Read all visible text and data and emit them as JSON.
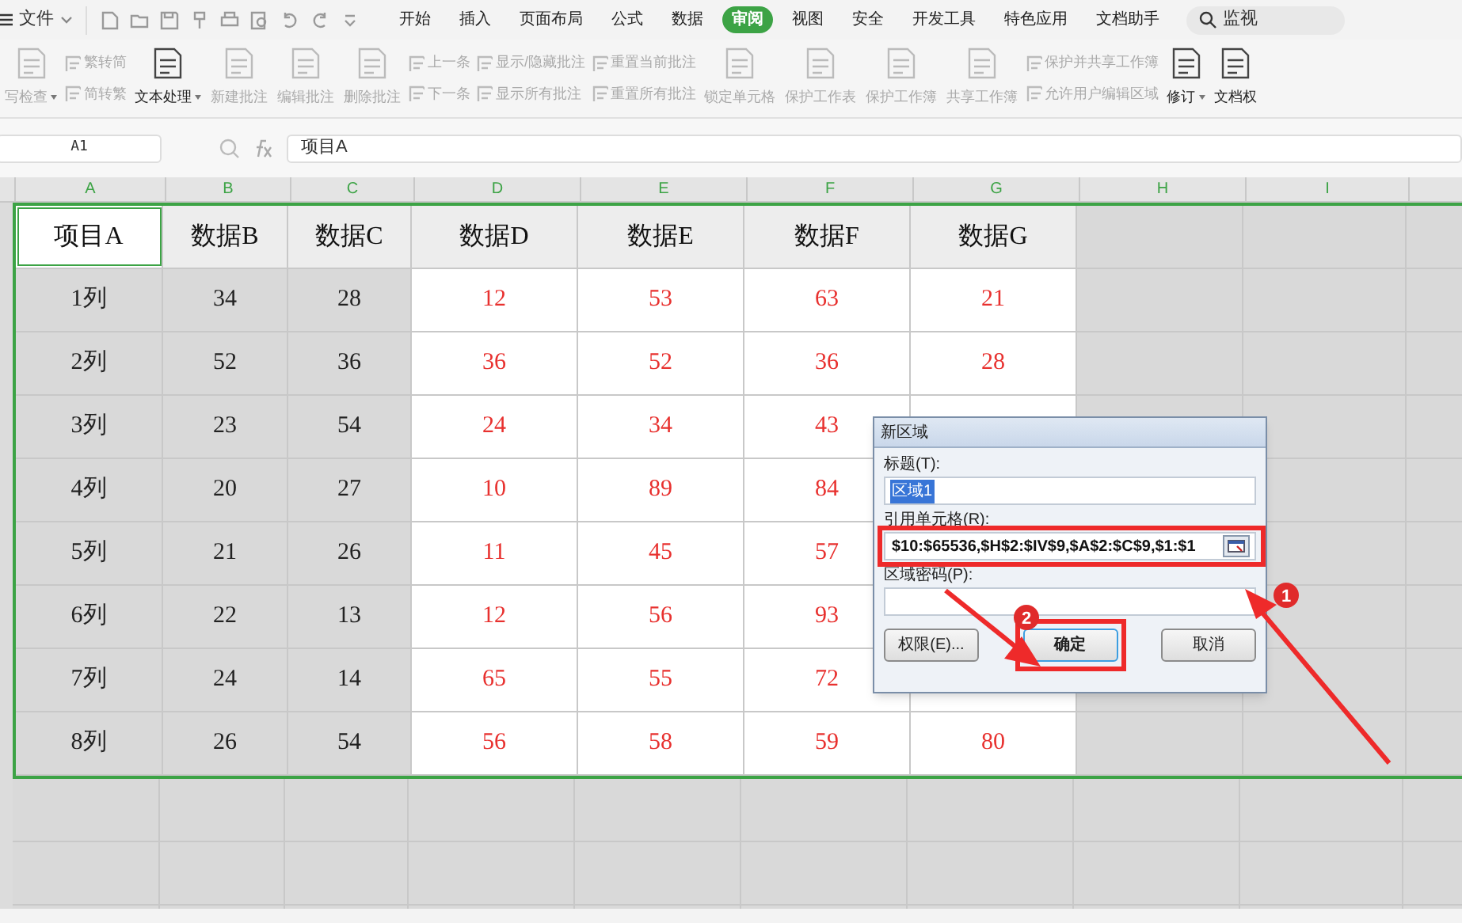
{
  "menu_bar": {
    "file_menu": "文件",
    "tabs": [
      {
        "label": "开始",
        "selected": false
      },
      {
        "label": "插入",
        "selected": false
      },
      {
        "label": "页面布局",
        "selected": false
      },
      {
        "label": "公式",
        "selected": false
      },
      {
        "label": "数据",
        "selected": false
      },
      {
        "label": "审阅",
        "selected": true
      },
      {
        "label": "视图",
        "selected": false
      },
      {
        "label": "安全",
        "selected": false
      },
      {
        "label": "开发工具",
        "selected": false
      },
      {
        "label": "特色应用",
        "selected": false
      },
      {
        "label": "文档助手",
        "selected": false
      }
    ],
    "search": {
      "value": "监视"
    }
  },
  "ribbon": [
    {
      "kind": "large",
      "label": "写检查",
      "disabled": true,
      "dropdown": true
    },
    {
      "kind": "pair",
      "items": [
        {
          "label": "繁转简",
          "disabled": true
        },
        {
          "label": "简转繁",
          "disabled": true
        }
      ]
    },
    {
      "kind": "large",
      "label": "文本处理",
      "disabled": false,
      "dropdown": true
    },
    {
      "kind": "large",
      "label": "新建批注",
      "disabled": true,
      "dropdown": false
    },
    {
      "kind": "large",
      "label": "编辑批注",
      "disabled": true,
      "dropdown": false
    },
    {
      "kind": "large",
      "label": "删除批注",
      "disabled": true,
      "dropdown": false
    },
    {
      "kind": "pair",
      "items": [
        {
          "label": "上一条",
          "disabled": true
        },
        {
          "label": "下一条",
          "disabled": true
        }
      ]
    },
    {
      "kind": "pair",
      "items": [
        {
          "label": "显示/隐藏批注",
          "disabled": true
        },
        {
          "label": "显示所有批注",
          "disabled": true
        }
      ]
    },
    {
      "kind": "pair",
      "items": [
        {
          "label": "重置当前批注",
          "disabled": true
        },
        {
          "label": "重置所有批注",
          "disabled": true
        }
      ]
    },
    {
      "kind": "large",
      "label": "锁定单元格",
      "disabled": true,
      "dropdown": false
    },
    {
      "kind": "large",
      "label": "保护工作表",
      "disabled": true,
      "dropdown": false
    },
    {
      "kind": "large",
      "label": "保护工作簿",
      "disabled": true,
      "dropdown": false
    },
    {
      "kind": "large",
      "label": "共享工作簿",
      "disabled": true,
      "dropdown": false
    },
    {
      "kind": "pair",
      "items": [
        {
          "label": "保护并共享工作簿",
          "disabled": true
        },
        {
          "label": "允许用户编辑区域",
          "disabled": true
        }
      ]
    },
    {
      "kind": "large",
      "label": "修订",
      "disabled": false,
      "dropdown": true
    },
    {
      "kind": "large",
      "label": "文档权",
      "disabled": false,
      "dropdown": false
    }
  ],
  "formula_bar": {
    "name_box": "A1",
    "formula": "项目A"
  },
  "sheet": {
    "columns": [
      {
        "label": "A",
        "shaded": true,
        "emphasis": false
      },
      {
        "label": "B",
        "shaded": true,
        "emphasis": false
      },
      {
        "label": "C",
        "shaded": true,
        "emphasis": false
      },
      {
        "label": "D",
        "shaded": false,
        "emphasis": true
      },
      {
        "label": "E",
        "shaded": false,
        "emphasis": true
      },
      {
        "label": "F",
        "shaded": false,
        "emphasis": true
      },
      {
        "label": "G",
        "shaded": false,
        "emphasis": true
      },
      {
        "label": "H",
        "shaded": true
      },
      {
        "label": "I",
        "shaded": true
      }
    ],
    "header_row": [
      {
        "text": "项目A",
        "selected": true
      },
      {
        "text": "数据B",
        "selected": false
      },
      {
        "text": "数据C",
        "selected": false
      },
      {
        "text": "数据D",
        "selected": false
      },
      {
        "text": "数据E",
        "selected": false
      },
      {
        "text": "数据F",
        "selected": false
      },
      {
        "text": "数据G",
        "selected": false
      }
    ],
    "rows": [
      [
        "1列",
        "34",
        "28",
        "12",
        "53",
        "63",
        "21"
      ],
      [
        "2列",
        "52",
        "36",
        "36",
        "52",
        "36",
        "28"
      ],
      [
        "3列",
        "23",
        "54",
        "24",
        "34",
        "43"
      ],
      [
        "4列",
        "20",
        "27",
        "10",
        "89",
        "84"
      ],
      [
        "5列",
        "21",
        "26",
        "11",
        "45",
        "57"
      ],
      [
        "6列",
        "22",
        "13",
        "12",
        "56",
        "93"
      ],
      [
        "7列",
        "24",
        "14",
        "65",
        "55",
        "72"
      ],
      [
        "8列",
        "26",
        "54",
        "56",
        "58",
        "59",
        "80"
      ]
    ]
  },
  "dialog": {
    "title": "新区域",
    "fields": [
      {
        "label": "标题(T):",
        "value": "区域1",
        "value_selected": true
      },
      {
        "label": "引用单元格(R):",
        "value": "$10:$65536,$H$2:$IV$9,$A$2:$C$9,$1:$1",
        "picker": true,
        "annotated": true
      },
      {
        "label": "区域密码(P):"
      }
    ],
    "buttons": [
      {
        "label": "权限(E)...",
        "default": false
      },
      {
        "label": "确定",
        "default": true,
        "annotated": true
      },
      {
        "label": "取消",
        "default": false
      }
    ]
  },
  "annotations": [
    {
      "number": "1"
    },
    {
      "number": "2"
    }
  ]
}
